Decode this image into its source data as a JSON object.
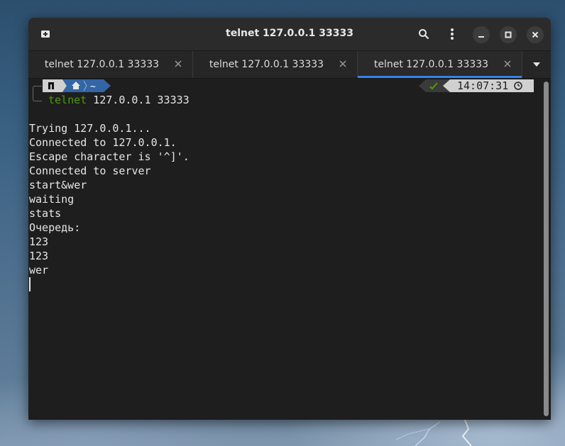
{
  "window": {
    "title": "telnet 127.0.0.1 33333"
  },
  "tabs": [
    {
      "label": "telnet 127.0.0.1 33333",
      "active": false
    },
    {
      "label": "telnet 127.0.0.1 33333",
      "active": false
    },
    {
      "label": "telnet 127.0.0.1 33333",
      "active": true
    }
  ],
  "prompt": {
    "os_icon": "arch-linux-icon",
    "home_icon": "home-icon",
    "path": "~",
    "command_name": "telnet",
    "command_args": " 127.0.0.1 33333",
    "status_icon": "checkmark-icon",
    "time": "14:07:31",
    "time_icon": "clock-icon"
  },
  "output_lines": [
    "Trying 127.0.0.1...",
    "Connected to 127.0.0.1.",
    "Escape character is '^]'.",
    "Connected to server",
    "start&wer",
    "waiting",
    "stats",
    "Очередь:",
    "123",
    "123",
    "wer"
  ],
  "colors": {
    "accent": "#3584e4",
    "command": "#4e9a06",
    "status_ok": "#4e9a06",
    "prompt_path_bg": "#3465a4",
    "terminal_bg": "#1e1e1e"
  }
}
